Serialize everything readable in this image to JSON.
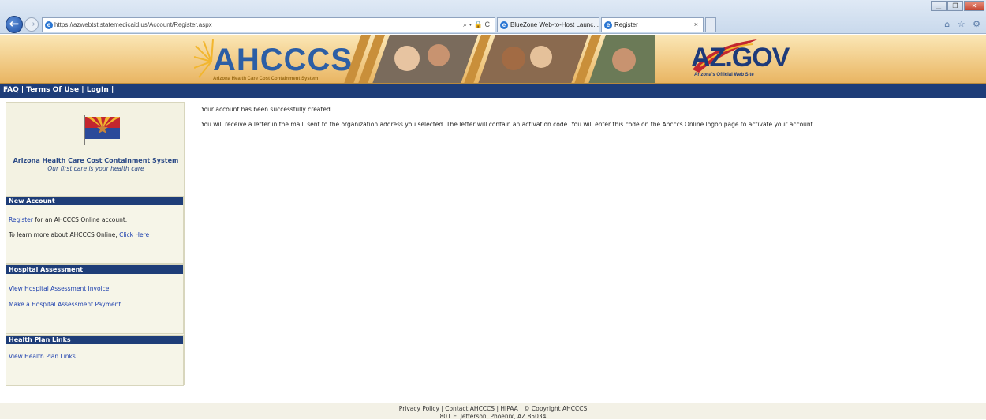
{
  "browser": {
    "url": "https://azwebtst.statemedicaid.us/Account/Register.aspx",
    "address_tools": "⌕ ▾ 🔒 C",
    "tabs": [
      {
        "label": "BlueZone Web-to-Host Launc..."
      },
      {
        "label": "Register",
        "close": "×"
      }
    ],
    "toolbar_icons": "⌂ ☆ ⚙"
  },
  "banner": {
    "logo_text": "AHCCCS",
    "logo_subtitle": "Arizona Health Care Cost Containment System",
    "azgov_text": "AZ.GOV",
    "azgov_subtitle": "Arizona's Official Web Site"
  },
  "nav": {
    "faq": "FAQ",
    "sep1": " | ",
    "terms": "Terms Of Use",
    "sep2": " | ",
    "login": "LogIn",
    "sep3": " |"
  },
  "sidebar": {
    "org_name": "Arizona Health Care Cost Containment System",
    "tagline": "Our first care is your health care",
    "new_account": {
      "heading": "New Account",
      "register_link": "Register",
      "register_rest": " for an AHCCCS Online account.",
      "learn_text": "To learn more about AHCCCS Online, ",
      "learn_link": "Click Here"
    },
    "hospital": {
      "heading": "Hospital Assessment",
      "link1": "View Hospital Assessment Invoice",
      "link2": "Make a Hospital Assessment Payment"
    },
    "health_plan": {
      "heading": "Health Plan Links",
      "link1": "View Health Plan Links"
    }
  },
  "main": {
    "message1": "Your account has been successfully created.",
    "message2": "You will receive a letter in the mail, sent to the organization address you selected. The letter will contain an activation code. You will enter this code on the Ahcccs Online logon page to activate your account."
  },
  "footer": {
    "privacy": "Privacy Policy",
    "contact": "Contact AHCCCS",
    "hipaa": "HIPAA",
    "copyright": "© Copyright AHCCCS",
    "address": "801 E. Jefferson, Phoenix, AZ 85034"
  },
  "colors": {
    "nav_blue": "#1e3d78",
    "link_blue": "#1c3fae",
    "banner_gold": "#e9b562"
  }
}
